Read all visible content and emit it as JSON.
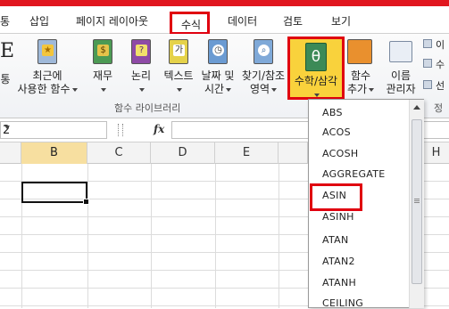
{
  "tabs": [
    "통",
    "삽입",
    "페이지 레이아웃",
    "수식",
    "데이터",
    "검토",
    "보기"
  ],
  "active_tab": "수식",
  "ribbon": {
    "partial_left": {
      "line1": "E",
      "line2": "통"
    },
    "recent": {
      "line1": "최근에",
      "line2": "사용한 함수"
    },
    "finance": {
      "line1": "재무"
    },
    "logic": {
      "line1": "논리"
    },
    "text": {
      "line1": "텍스트"
    },
    "datetime": {
      "line1": "날짜 및",
      "line2": "시간"
    },
    "lookup": {
      "line1": "찾기/참조",
      "line2": "영역"
    },
    "math": {
      "line1": "수학/삼각"
    },
    "more": {
      "line1": "함수",
      "line2": "추가"
    },
    "names": {
      "line1": "이름",
      "line2": "관리자"
    },
    "group_label": "함수 라이브러리",
    "right_partial": [
      "정",
      "이",
      "수",
      "선"
    ]
  },
  "formula_bar": {
    "name_box": "2",
    "fx": "fx"
  },
  "columns": [
    "B",
    "C",
    "D",
    "E",
    "H"
  ],
  "dropdown": {
    "items": [
      "ABS",
      "ACOS",
      "ACOSH",
      "AGGREGATE",
      "ASIN",
      "ASINH",
      "ATAN",
      "ATAN2",
      "ATANH",
      "CEILING"
    ],
    "highlighted": "ASIN"
  },
  "colors": {
    "accent_red": "#e0000f",
    "highlight_yellow": "#f9d23c",
    "excel_green": "#3c8a57"
  }
}
